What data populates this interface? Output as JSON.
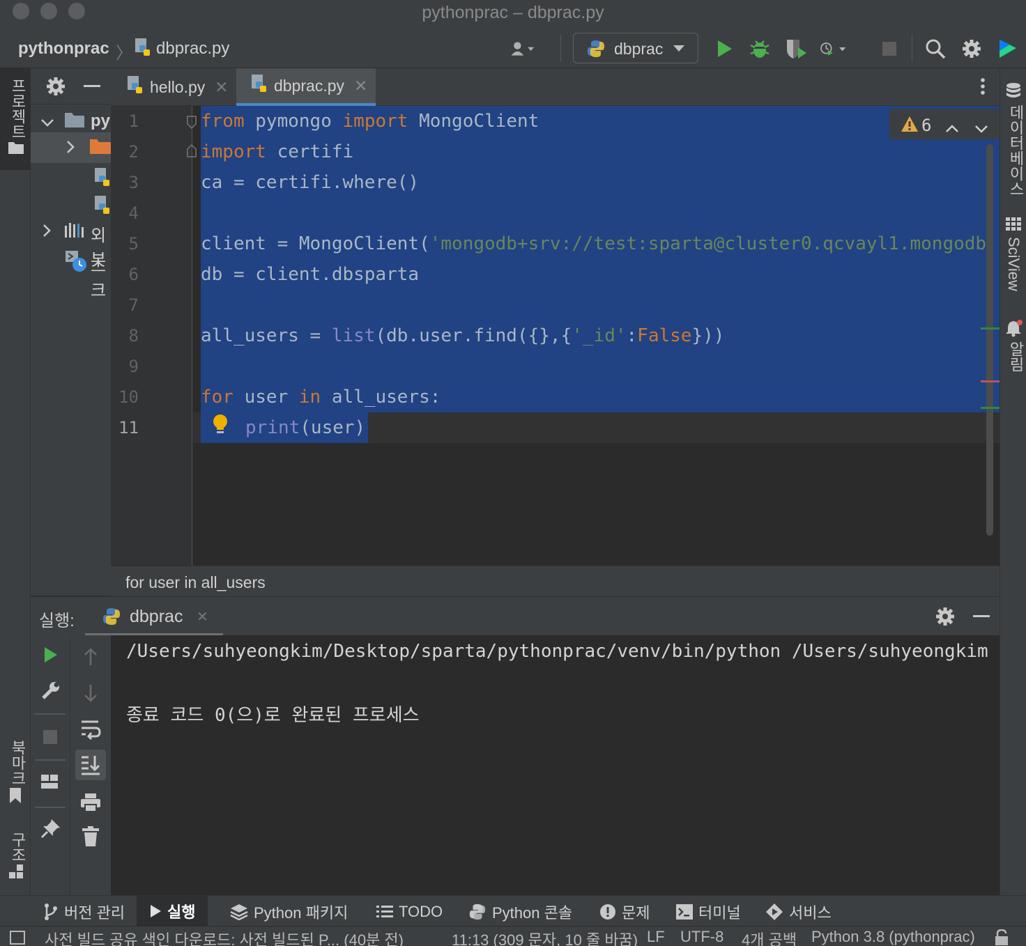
{
  "window": {
    "title": "pythonprac – dbprac.py"
  },
  "navbar": {
    "project": "pythonprac",
    "file": "dbprac.py",
    "run_config": "dbprac"
  },
  "project_panel": {
    "root_label": "py",
    "external_label": "외부",
    "scratch_label": "스크"
  },
  "left_stripe": {
    "project": "프로젝트",
    "bookmarks": "북마크",
    "structure": "구조"
  },
  "right_stripe": {
    "database": "데이터베이스",
    "sciview": "SciView",
    "notifications": "알림"
  },
  "tabs": [
    {
      "label": "hello.py",
      "active": false
    },
    {
      "label": "dbprac.py",
      "active": true
    }
  ],
  "editor": {
    "inspection_count": "6",
    "line_numbers": [
      "1",
      "2",
      "3",
      "4",
      "5",
      "6",
      "7",
      "8",
      "9",
      "10",
      "11"
    ],
    "current_line": "11"
  },
  "code": {
    "l1": [
      "from",
      " pymongo ",
      "import",
      " MongoClient"
    ],
    "l2": [
      "import",
      " certifi"
    ],
    "l3": "ca = certifi.where()",
    "l5": [
      "client = MongoClient(",
      "'mongodb+srv://test:sparta@cluster0.qcvayl1.mongodb"
    ],
    "l6": "db = client.dbsparta",
    "l8": [
      "all_users = ",
      "list",
      "(db.user.find({},{",
      "'_id'",
      ":",
      "False",
      "}))"
    ],
    "l10": [
      "for",
      " user ",
      "in",
      " all_users:"
    ],
    "l11": [
      "print",
      "(user)"
    ]
  },
  "breadcrumb": "for user in all_users",
  "run_panel": {
    "label": "실행:",
    "tab": "dbprac",
    "console_line1": "/Users/suhyeongkim/Desktop/sparta/pythonprac/venv/bin/python /Users/suhyeongkim",
    "console_line2": "종료 코드 0(으)로 완료된 프로세스"
  },
  "bottom_tools": [
    "버전 관리",
    "실행",
    "Python 패키지",
    "TODO",
    "Python 콘솔",
    "문제",
    "터미널",
    "서비스"
  ],
  "status": {
    "message": "사전 빌드 공유 색인 다운로드: 사전 빌드된 P... (40분 전)",
    "position": "11:13 (309 문자, 10 줄 바꿈)",
    "line_sep": "LF",
    "encoding": "UTF-8",
    "indent": "4개 공백",
    "interpreter": "Python 3.8 (pythonprac)"
  },
  "colors": {
    "selection": "#214283",
    "keyword": "#cc7832",
    "string": "#6a8759",
    "run_green": "#4caf50"
  }
}
